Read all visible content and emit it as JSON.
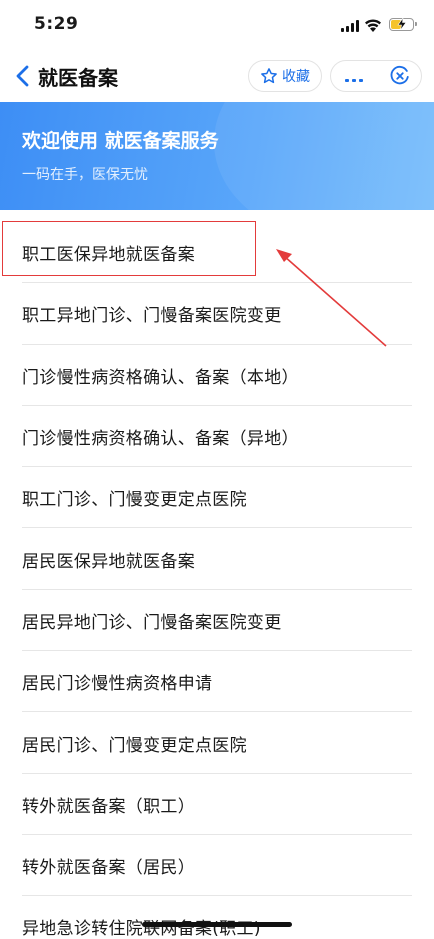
{
  "status_bar": {
    "time": "5:29"
  },
  "nav": {
    "title": "就医备案",
    "favorite_label": "收藏"
  },
  "banner": {
    "title": "欢迎使用 就医备案服务",
    "subtitle": "一码在手，医保无忧"
  },
  "list": {
    "items": [
      "职工医保异地就医备案",
      "职工异地门诊、门慢备案医院变更",
      "门诊慢性病资格确认、备案（本地）",
      "门诊慢性病资格确认、备案（异地）",
      "职工门诊、门慢变更定点医院",
      "居民医保异地就医备案",
      "居民异地门诊、门慢备案医院变更",
      "居民门诊慢性病资格申请",
      "居民门诊、门慢变更定点医院",
      "转外就医备案（职工）",
      "转外就医备案（居民）",
      "异地急诊转住院联网备案(职工)"
    ]
  },
  "colors": {
    "accent": "#1c6fe8",
    "banner_start": "#3d8ef5",
    "banner_end": "#77bdfb",
    "annotation": "#e33b3b"
  },
  "icons": {
    "back": "chevron-left-icon",
    "favorite": "star-outline-icon",
    "more": "more-dots-icon",
    "close": "close-circle-icon"
  }
}
